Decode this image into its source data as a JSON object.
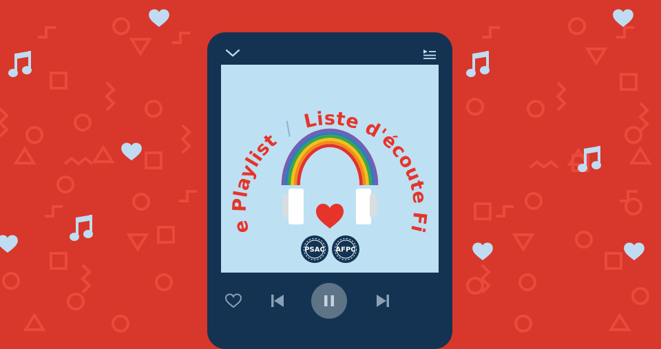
{
  "playlist": {
    "title_en": "Pride Playlist",
    "title_fr": "Liste d'écoute Fierté",
    "separator": "/",
    "logos": [
      "PSAC",
      "AFPC"
    ]
  },
  "player": {
    "collapse_icon": "chevron-down-icon",
    "queue_icon": "queue-list-icon",
    "controls": [
      "heart-icon",
      "previous-track-icon",
      "pause-icon",
      "next-track-icon"
    ],
    "state": "playing"
  },
  "colors": {
    "background": "#d8372b",
    "pattern": "#ea4a3c",
    "phone": "#143352",
    "artwork": "#bee0f3",
    "accent_red": "#e6342b",
    "decor_blue": "#bfdcf2"
  }
}
